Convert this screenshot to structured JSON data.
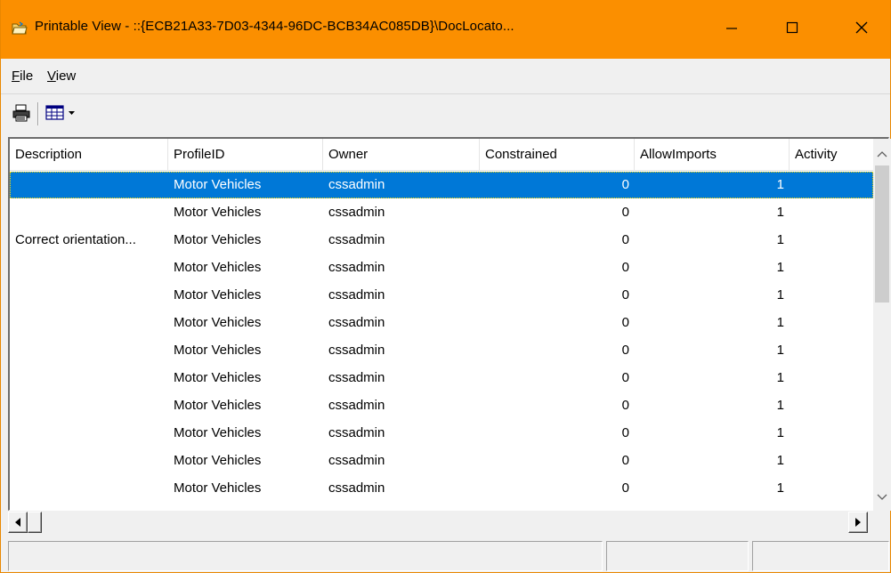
{
  "window": {
    "title": "Printable View - ::{ECB21A33-7D03-4344-96DC-BCB34AC085DB}\\DocLocato...",
    "title_bar_color": "#fb8f00"
  },
  "menu": {
    "file_hotkey": "F",
    "file_rest": "ile",
    "view_hotkey": "V",
    "view_rest": "iew"
  },
  "toolbar": {
    "print_icon": "printer-icon",
    "view_icon": "grid-view-icon"
  },
  "table": {
    "columns": [
      "Description",
      "ProfileID",
      "Owner",
      "Constrained",
      "AllowImports",
      "Activity"
    ],
    "selected_row": 0,
    "selection_color": "#0078d7",
    "rows": [
      {
        "description": "",
        "profile": "Motor Vehicles",
        "owner": "cssadmin",
        "constrained": "0",
        "allow": "1"
      },
      {
        "description": "",
        "profile": "Motor Vehicles",
        "owner": "cssadmin",
        "constrained": "0",
        "allow": "1"
      },
      {
        "description": "Correct orientation...",
        "profile": "Motor Vehicles",
        "owner": "cssadmin",
        "constrained": "0",
        "allow": "1"
      },
      {
        "description": "",
        "profile": "Motor Vehicles",
        "owner": "cssadmin",
        "constrained": "0",
        "allow": "1"
      },
      {
        "description": "",
        "profile": "Motor Vehicles",
        "owner": "cssadmin",
        "constrained": "0",
        "allow": "1"
      },
      {
        "description": "",
        "profile": "Motor Vehicles",
        "owner": "cssadmin",
        "constrained": "0",
        "allow": "1"
      },
      {
        "description": "",
        "profile": "Motor Vehicles",
        "owner": "cssadmin",
        "constrained": "0",
        "allow": "1"
      },
      {
        "description": "",
        "profile": "Motor Vehicles",
        "owner": "cssadmin",
        "constrained": "0",
        "allow": "1"
      },
      {
        "description": "",
        "profile": "Motor Vehicles",
        "owner": "cssadmin",
        "constrained": "0",
        "allow": "1"
      },
      {
        "description": "",
        "profile": "Motor Vehicles",
        "owner": "cssadmin",
        "constrained": "0",
        "allow": "1"
      },
      {
        "description": "",
        "profile": "Motor Vehicles",
        "owner": "cssadmin",
        "constrained": "0",
        "allow": "1"
      },
      {
        "description": "",
        "profile": "Motor Vehicles",
        "owner": "cssadmin",
        "constrained": "0",
        "allow": "1"
      }
    ]
  },
  "statusbar": {
    "panel1": "",
    "panel2": "",
    "panel3": ""
  }
}
